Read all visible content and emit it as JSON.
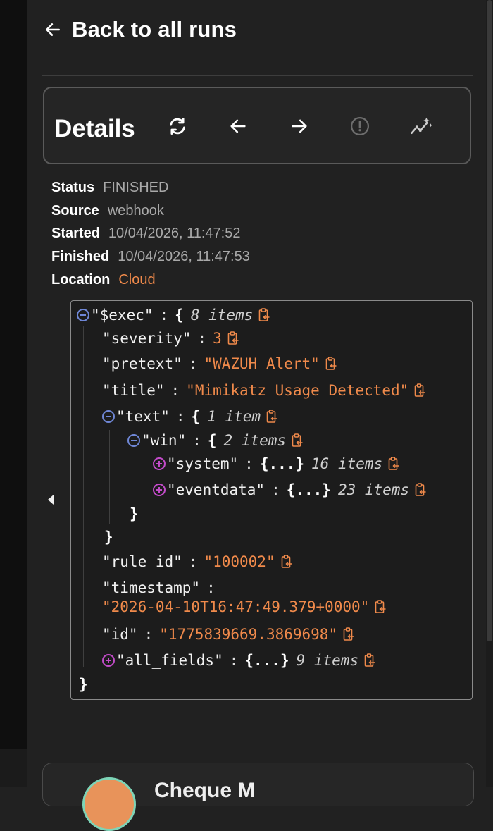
{
  "header": {
    "back_label": "Back to all runs"
  },
  "details": {
    "title": "Details",
    "tools": [
      "refresh-icon",
      "arrow-left-icon",
      "arrow-right-icon",
      "alert-circle-icon",
      "sparkline-icon"
    ]
  },
  "meta": [
    {
      "key": "Status",
      "value": "FINISHED"
    },
    {
      "key": "Source",
      "value": "webhook"
    },
    {
      "key": "Started",
      "value": "10/04/2026, 11:47:52"
    },
    {
      "key": "Finished",
      "value": "10/04/2026, 11:47:53"
    },
    {
      "key": "Location",
      "value": "Cloud"
    }
  ],
  "json": {
    "root_key": "\"$exec\"",
    "root_count": "8 items",
    "severity_key": "\"severity\"",
    "severity_val": "3",
    "pretext_key": "\"pretext\"",
    "pretext_val": "\"WAZUH Alert\"",
    "title_key": "\"title\"",
    "title_val": "\"Mimikatz Usage Detected\"",
    "text_key": "\"text\"",
    "text_count": "1 item",
    "win_key": "\"win\"",
    "win_count": "2 items",
    "system_key": "\"system\"",
    "system_count": "16 items",
    "eventdata_key": "\"eventdata\"",
    "eventdata_count": "23 items",
    "rule_id_key": "\"rule_id\"",
    "rule_id_val": "\"100002\"",
    "timestamp_key": "\"timestamp\"",
    "timestamp_val": "\"2026-04-10T16:47:49.379+0000\"",
    "id_key": "\"id\"",
    "id_val": "\"1775839669.3869698\"",
    "all_fields_key": "\"all_fields\"",
    "all_fields_count": "9 items",
    "collapsed": "{...}",
    "open_brace": "{",
    "close_brace": "}",
    "colon": ":"
  },
  "card": {
    "name": "Cheque M"
  },
  "colors": {
    "accent": "#f08a4b",
    "minus_toggle": "#6f87d6",
    "plus_toggle": "#c34bc9",
    "background": "#212121"
  }
}
